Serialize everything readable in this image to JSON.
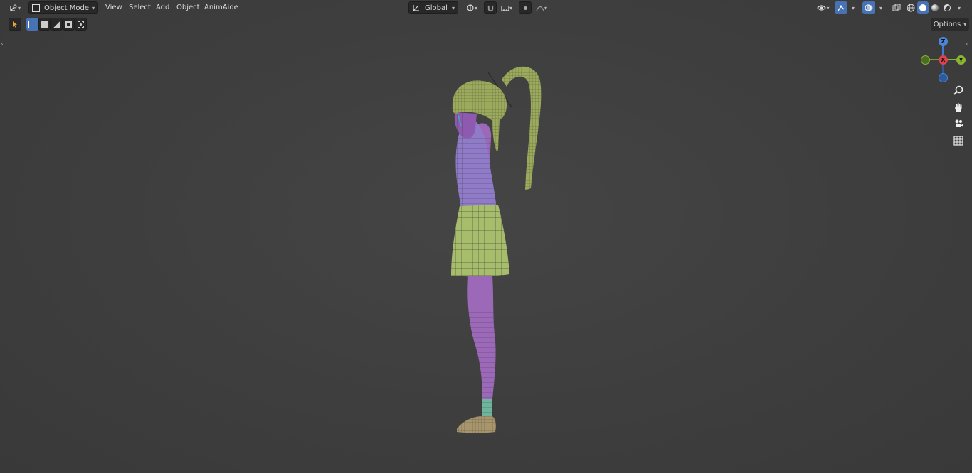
{
  "header": {
    "mode_label": "Object Mode",
    "menus": [
      "View",
      "Select",
      "Add",
      "Object",
      "AnimAide"
    ],
    "orientation_label": "Global",
    "options_label": "Options"
  },
  "gizmo": {
    "z": "Z",
    "x": "X",
    "y": "Y"
  },
  "colors": {
    "accent": "#4772b3",
    "hair": "#9caa5c",
    "body": "#8f7bc8",
    "skin": "#9b69b8",
    "skirt": "#a7bd6b",
    "sock": "#6fb59d",
    "shoe": "#a8956b"
  }
}
